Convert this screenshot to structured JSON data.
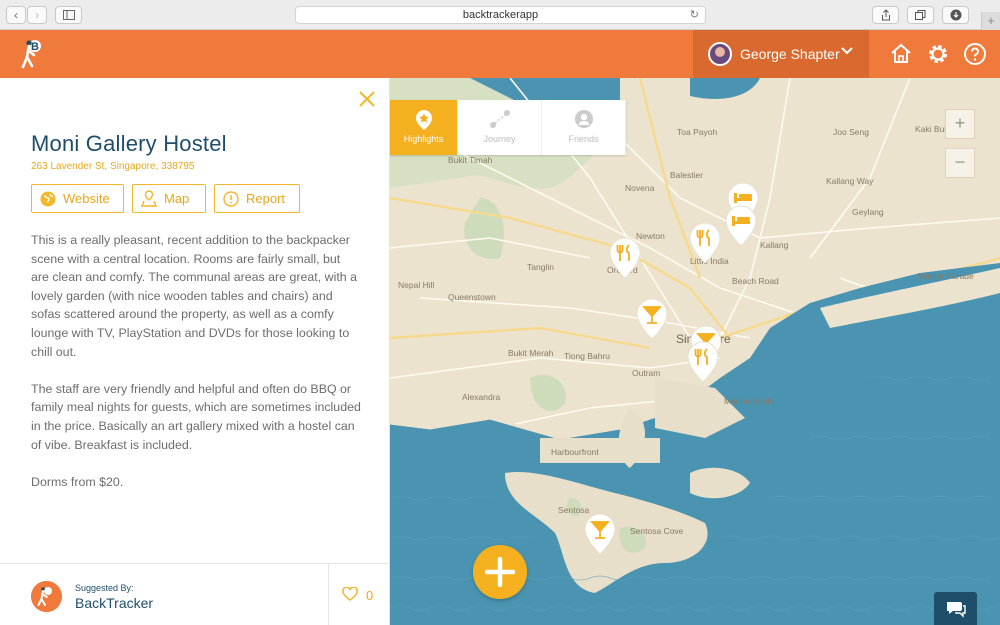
{
  "browser": {
    "url": "backtrackerapp",
    "back_icon": "chevron-left-icon",
    "forward_icon": "chevron-right-icon"
  },
  "header": {
    "user_name": "George Shapter",
    "bg_color": "#f07a3b",
    "icons": [
      "home-icon",
      "gear-icon",
      "help-icon"
    ]
  },
  "place": {
    "title": "Moni Gallery Hostel",
    "address": "263 Lavender St, Singapore, 338795",
    "buttons": {
      "website": "Website",
      "map": "Map",
      "report": "Report"
    },
    "description": [
      "This is a really pleasant, recent addition to the backpacker scene with a central location. Rooms are fairly small, but are clean and comfy. The communal areas are great, with a lovely garden (with nice wooden tables and chairs) and sofas scattered around the property, as well as a comfy lounge with TV, PlayStation and DVDs for those looking to chill out.",
      "The staff are very friendly and helpful and often do BBQ or family meal nights for guests, which are sometimes included in the price. Basically an art gallery mixed with a hostel can of vibe. Breakfast is included.",
      "Dorms from $20."
    ],
    "suggested_label": "Suggested By:",
    "suggested_by": "BackTracker",
    "likes": "0"
  },
  "map": {
    "tabs": [
      {
        "label": "Highlights",
        "icon": "star-pin-icon",
        "active": true
      },
      {
        "label": "Journey",
        "icon": "route-icon",
        "active": false
      },
      {
        "label": "Friends",
        "icon": "person-icon",
        "active": false
      }
    ],
    "zoom_in": "+",
    "zoom_out": "−",
    "labels": [
      "Toa Payoh",
      "Joo Seng",
      "Kaki Bukit",
      "Bukit Timah",
      "Balestier",
      "Kallang Way",
      "Novena",
      "Geylang",
      "Newton",
      "Kallang",
      "Little India",
      "Tanglin",
      "Orchard",
      "Beach Road",
      "Nepal Hill",
      "Queenstown",
      "Marine Parade",
      "Singapore",
      "Bukit Merah",
      "Tiong Bahru",
      "Outram",
      "Alexandra",
      "Marina South",
      "Harbourfront",
      "Sentosa",
      "Sentosa Cove"
    ],
    "accent": "#f5b01f"
  }
}
